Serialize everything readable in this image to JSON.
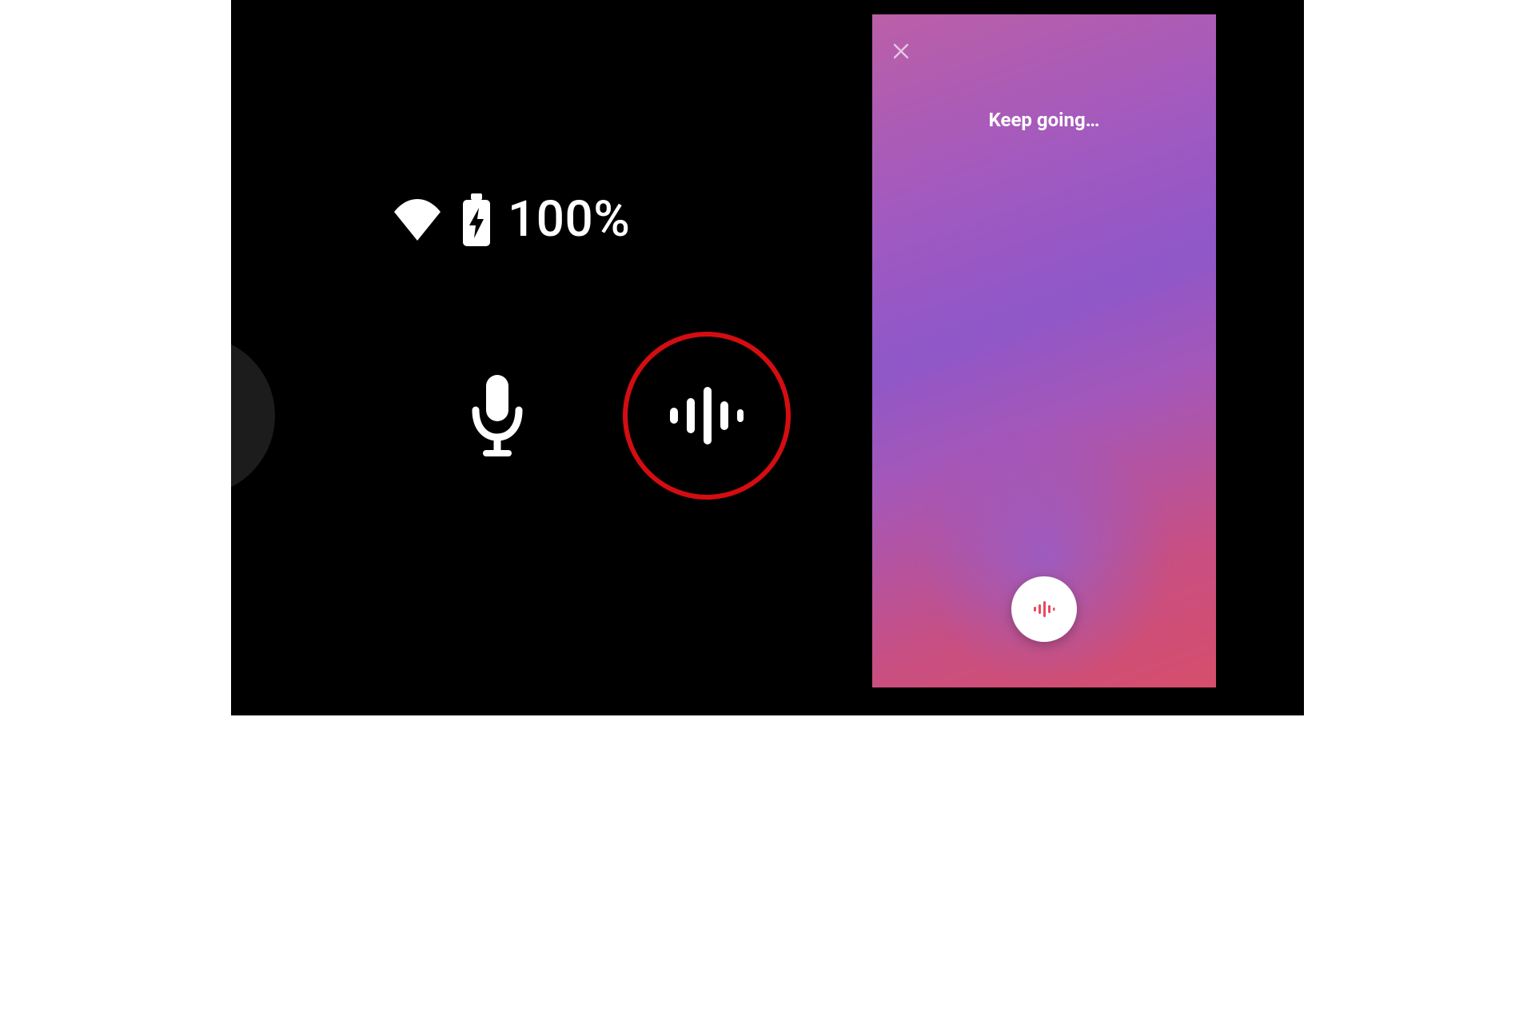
{
  "status": {
    "battery_label": "100%"
  },
  "phone": {
    "title": "Keep going…"
  },
  "colors": {
    "highlight_ring": "#d40d11",
    "fab_icon": "#e84a5f"
  }
}
